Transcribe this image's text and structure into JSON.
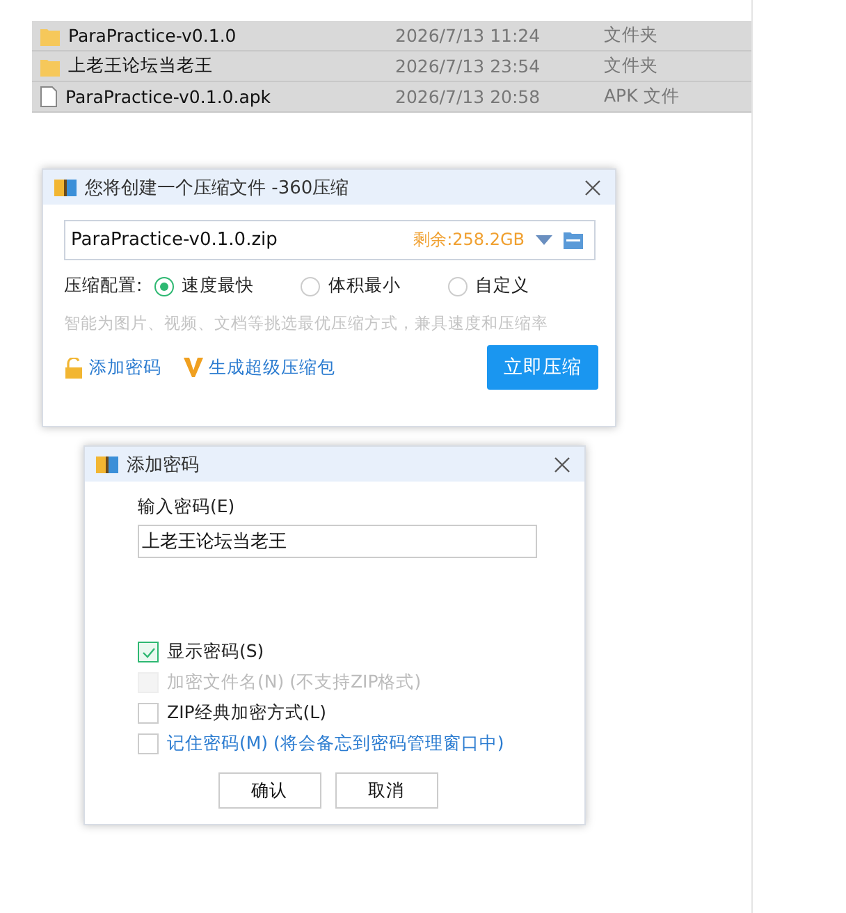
{
  "files": [
    {
      "name": "ParaPractice-v0.1.0",
      "date": "2026/7/13 11:24",
      "type": "文件夹",
      "kind": "folder",
      "selected": true
    },
    {
      "name": "上老王论坛当老王",
      "date": "2026/7/13 23:54",
      "type": "文件夹",
      "kind": "folder",
      "selected": true
    },
    {
      "name": "ParaPractice-v0.1.0.apk",
      "date": "2026/7/13 20:58",
      "type": "APK 文件",
      "kind": "file",
      "selected": true
    }
  ],
  "compress_dialog": {
    "title": "您将创建一个压缩文件 -360压缩",
    "filename": "ParaPractice-v0.1.0.zip",
    "free_space": "剩余:258.2GB",
    "config_label": "压缩配置:",
    "options": [
      {
        "label": "速度最快",
        "selected": true
      },
      {
        "label": "体积最小",
        "selected": false
      },
      {
        "label": "自定义",
        "selected": false
      }
    ],
    "hint": "智能为图片、视频、文档等挑选最优压缩方式，兼具速度和压缩率",
    "add_password": "添加密码",
    "super_pack": "生成超级压缩包",
    "compress_button": "立即压缩"
  },
  "password_dialog": {
    "title": "添加密码",
    "input_label": "输入密码(E)",
    "password": "上老王论坛当老王",
    "checkboxes": [
      {
        "label": "显示密码(S)",
        "checked": true,
        "disabled": false,
        "kind": "plain"
      },
      {
        "label": "加密文件名(N) (不支持ZIP格式)",
        "checked": false,
        "disabled": true,
        "kind": "plain"
      },
      {
        "label": "ZIP经典加密方式(L)",
        "checked": false,
        "disabled": false,
        "kind": "plain"
      },
      {
        "label": "记住密码(M) (将会备忘到密码管理窗口中)",
        "checked": false,
        "disabled": false,
        "kind": "link"
      }
    ],
    "buttons": [
      "确认",
      "取消"
    ]
  }
}
